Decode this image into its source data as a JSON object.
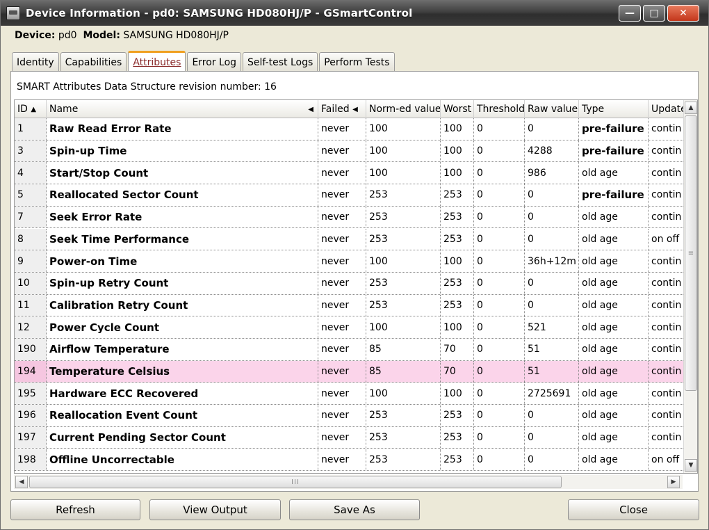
{
  "window": {
    "title": "Device Information - pd0: SAMSUNG HD080HJ/P - GSmartControl",
    "minimize": "—",
    "maximize": "□",
    "close": "✕"
  },
  "device": {
    "device_label": "Device:",
    "device_value": "pd0",
    "model_label": "Model:",
    "model_value": "SAMSUNG HD080HJ/P"
  },
  "tabs": [
    {
      "label": "Identity"
    },
    {
      "label": "Capabilities"
    },
    {
      "label": "Attributes"
    },
    {
      "label": "Error Log"
    },
    {
      "label": "Self-test Logs"
    },
    {
      "label": "Perform Tests"
    }
  ],
  "revision_text": "SMART Attributes Data Structure revision number: 16",
  "columns": {
    "id": "ID",
    "id_sort": "▲",
    "name": "Name",
    "name_arrow": "◀",
    "failed": "Failed",
    "failed_arrow": "◀",
    "normed": "Norm-ed value",
    "worst": "Worst",
    "threshold": "Threshold",
    "raw": "Raw value",
    "type": "Type",
    "update": "Update"
  },
  "rows": [
    {
      "id": "1",
      "name": "Raw Read Error Rate",
      "failed": "never",
      "normed": "100",
      "worst": "100",
      "threshold": "0",
      "raw": "0",
      "type": "pre-failure",
      "update": "contin"
    },
    {
      "id": "3",
      "name": "Spin-up Time",
      "failed": "never",
      "normed": "100",
      "worst": "100",
      "threshold": "0",
      "raw": "4288",
      "type": "pre-failure",
      "update": "contin"
    },
    {
      "id": "4",
      "name": "Start/Stop Count",
      "failed": "never",
      "normed": "100",
      "worst": "100",
      "threshold": "0",
      "raw": "986",
      "type": "old age",
      "update": "contin"
    },
    {
      "id": "5",
      "name": "Reallocated Sector Count",
      "failed": "never",
      "normed": "253",
      "worst": "253",
      "threshold": "0",
      "raw": "0",
      "type": "pre-failure",
      "update": "contin"
    },
    {
      "id": "7",
      "name": "Seek Error Rate",
      "failed": "never",
      "normed": "253",
      "worst": "253",
      "threshold": "0",
      "raw": "0",
      "type": "old age",
      "update": "contin"
    },
    {
      "id": "8",
      "name": "Seek Time Performance",
      "failed": "never",
      "normed": "253",
      "worst": "253",
      "threshold": "0",
      "raw": "0",
      "type": "old age",
      "update": "on off"
    },
    {
      "id": "9",
      "name": "Power-on Time",
      "failed": "never",
      "normed": "100",
      "worst": "100",
      "threshold": "0",
      "raw": "36h+12m",
      "type": "old age",
      "update": "contin"
    },
    {
      "id": "10",
      "name": "Spin-up Retry Count",
      "failed": "never",
      "normed": "253",
      "worst": "253",
      "threshold": "0",
      "raw": "0",
      "type": "old age",
      "update": "contin"
    },
    {
      "id": "11",
      "name": "Calibration Retry Count",
      "failed": "never",
      "normed": "253",
      "worst": "253",
      "threshold": "0",
      "raw": "0",
      "type": "old age",
      "update": "contin"
    },
    {
      "id": "12",
      "name": "Power Cycle Count",
      "failed": "never",
      "normed": "100",
      "worst": "100",
      "threshold": "0",
      "raw": "521",
      "type": "old age",
      "update": "contin"
    },
    {
      "id": "190",
      "name": "Airflow Temperature",
      "failed": "never",
      "normed": "85",
      "worst": "70",
      "threshold": "0",
      "raw": "51",
      "type": "old age",
      "update": "contin"
    },
    {
      "id": "194",
      "name": "Temperature Celsius",
      "failed": "never",
      "normed": "85",
      "worst": "70",
      "threshold": "0",
      "raw": "51",
      "type": "old age",
      "update": "contin",
      "selected": true
    },
    {
      "id": "195",
      "name": "Hardware ECC Recovered",
      "failed": "never",
      "normed": "100",
      "worst": "100",
      "threshold": "0",
      "raw": "2725691",
      "type": "old age",
      "update": "contin"
    },
    {
      "id": "196",
      "name": "Reallocation Event Count",
      "failed": "never",
      "normed": "253",
      "worst": "253",
      "threshold": "0",
      "raw": "0",
      "type": "old age",
      "update": "contin"
    },
    {
      "id": "197",
      "name": "Current Pending Sector Count",
      "failed": "never",
      "normed": "253",
      "worst": "253",
      "threshold": "0",
      "raw": "0",
      "type": "old age",
      "update": "contin"
    },
    {
      "id": "198",
      "name": "Offline Uncorrectable",
      "failed": "never",
      "normed": "253",
      "worst": "253",
      "threshold": "0",
      "raw": "0",
      "type": "old age",
      "update": "on off"
    }
  ],
  "scroll": {
    "up": "▲",
    "down": "▼",
    "left": "◀",
    "right": "▶",
    "vgrip": "≡",
    "hgrip": "III"
  },
  "buttons": {
    "refresh": "Refresh",
    "view_output": "View Output",
    "save_as": "Save As",
    "close": "Close"
  },
  "colors": {
    "selected_row": "#fbd4ea",
    "active_tab_accent": "#f0a020"
  }
}
